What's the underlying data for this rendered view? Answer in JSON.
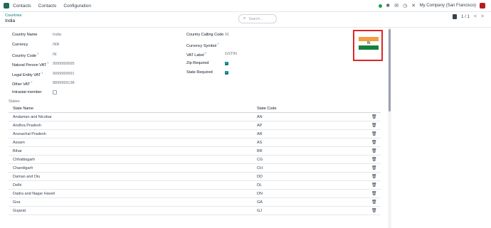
{
  "navbar": {
    "menu": [
      "Contacts",
      "Contacts",
      "Configuration"
    ],
    "company": "My Company (San Francisco)"
  },
  "control": {
    "breadcrumb": "Countries",
    "record": "India",
    "search_placeholder": "Search...",
    "pager": "1 / 1",
    "prev": "<",
    "next": ">"
  },
  "form": {
    "left": [
      {
        "label": "Country Name",
        "value": "India",
        "type": "text"
      },
      {
        "label": "Currency",
        "value": "INR",
        "type": "text"
      },
      {
        "label": "Country Code",
        "value": "IN",
        "type": "text",
        "required": true
      },
      {
        "label": "Natural Person VAT",
        "value": "9999999995",
        "type": "text",
        "required": true
      },
      {
        "label": "Legal Entity VAT",
        "value": "9999999991",
        "type": "text",
        "required": true
      },
      {
        "label": "Other VAT",
        "value": "8899999138",
        "type": "text",
        "required": true
      },
      {
        "label": "Intrastat member",
        "value": "",
        "type": "checkbox",
        "checked": false
      }
    ],
    "right": [
      {
        "label": "Country Calling Code",
        "value": "91",
        "type": "text"
      },
      {
        "label": "Currency Symbol",
        "value": "",
        "type": "text",
        "required": true
      },
      {
        "label": "VAT Label",
        "value": "GSTIN",
        "type": "text",
        "required": true
      },
      {
        "label": "Zip Required",
        "value": "",
        "type": "checkbox",
        "checked": true
      },
      {
        "label": "State Required",
        "value": "",
        "type": "checkbox",
        "checked": true
      }
    ],
    "flag_text": "IN"
  },
  "states": {
    "title": "States",
    "headers": [
      "State Name",
      "State Code"
    ],
    "rows": [
      {
        "name": "Andaman and Nicobar",
        "code": "AN"
      },
      {
        "name": "Andhra Pradesh",
        "code": "AP"
      },
      {
        "name": "Arunachal Pradesh",
        "code": "AR"
      },
      {
        "name": "Assam",
        "code": "AS"
      },
      {
        "name": "Bihar",
        "code": "BR"
      },
      {
        "name": "Chhattisgarh",
        "code": "CG"
      },
      {
        "name": "Chandigarh",
        "code": "CH"
      },
      {
        "name": "Daman and Diu",
        "code": "DD"
      },
      {
        "name": "Delhi",
        "code": "DL"
      },
      {
        "name": "Dadra and Nagar Haveli",
        "code": "DN"
      },
      {
        "name": "Goa",
        "code": "GA"
      },
      {
        "name": "Gujarat",
        "code": "GJ"
      }
    ]
  },
  "colors": {
    "accent": "#017e84",
    "highlight": "#dc2626"
  },
  "icons": [
    "app-icon",
    "status-dot-icon",
    "bug-icon",
    "chat-icon",
    "clock-icon",
    "tools-icon",
    "search-icon",
    "gear-icon",
    "trash-icon"
  ]
}
